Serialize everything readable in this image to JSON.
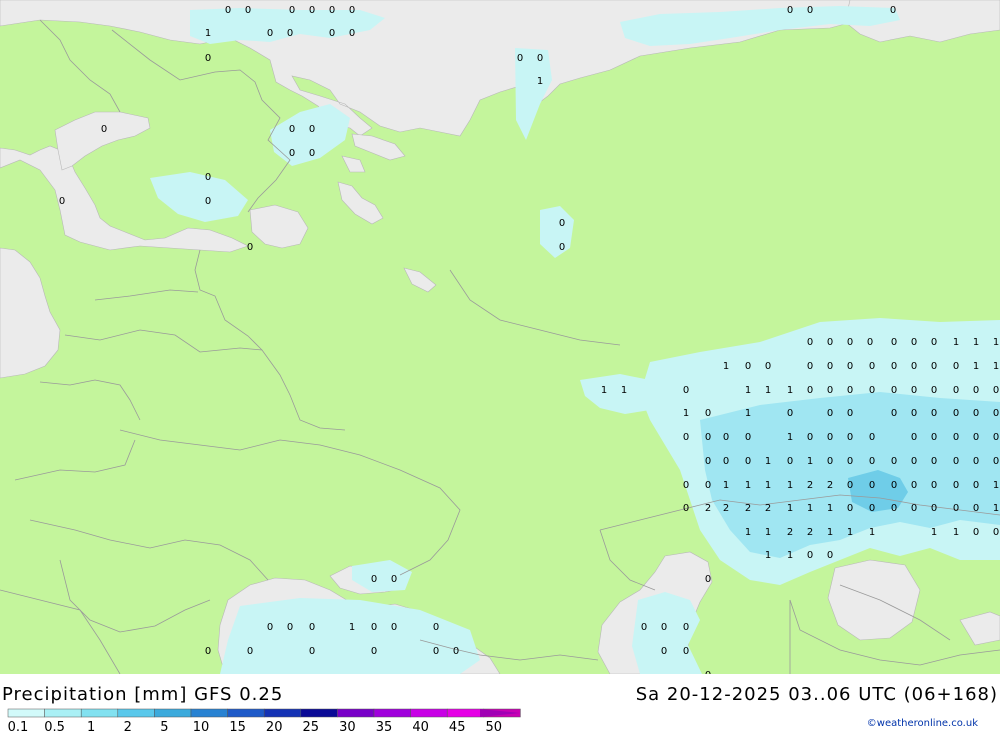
{
  "title": "Precipitation [mm] GFS 0.25",
  "valid_time": "Sa 20-12-2025 03..06 UTC (06+168)",
  "credit": "©weatheronline.co.uk",
  "colors": {
    "land": "#c4f59c",
    "sea": "#ebebeb",
    "border": "#9a9a9a",
    "precip_light": "#c8f5f5",
    "precip_mid": "#a0e6f2",
    "precip_heavy": "#6fcde8"
  },
  "legend": {
    "ticks": [
      "0.1",
      "0.5",
      "1",
      "2",
      "5",
      "10",
      "15",
      "20",
      "25",
      "30",
      "35",
      "40",
      "45",
      "50"
    ],
    "colors": [
      "#d2fafa",
      "#aaf0f5",
      "#82e1f0",
      "#5ac8eb",
      "#3caadc",
      "#2882d2",
      "#1e5ac8",
      "#1432b4",
      "#0a0a96",
      "#7800c8",
      "#a000dc",
      "#c800e6",
      "#e600e6",
      "#c800b4"
    ]
  },
  "values": [
    "0",
    "0",
    "0",
    "0",
    "0",
    "0",
    "0",
    "0",
    "0",
    "1",
    "0",
    "0",
    "0",
    "0",
    "0",
    "0",
    "0",
    "1",
    "0",
    "0",
    "0",
    "0",
    "0",
    "0",
    "0",
    "0",
    "0",
    "0",
    "0",
    "0",
    "0",
    "0",
    "0",
    "0",
    "0",
    "0",
    "1",
    "1",
    "1",
    "1",
    "0",
    "0",
    "0",
    "0",
    "0",
    "0",
    "0",
    "0",
    "0",
    "0",
    "1",
    "1",
    "1",
    "1",
    "0",
    "1",
    "1",
    "1",
    "0",
    "0",
    "0",
    "0",
    "0",
    "0",
    "0",
    "0",
    "0",
    "0",
    "1",
    "0",
    "1",
    "0",
    "0",
    "0",
    "0",
    "0",
    "0",
    "0",
    "0",
    "0",
    "0",
    "0",
    "0",
    "0",
    "1",
    "0",
    "0",
    "0",
    "0",
    "0",
    "0",
    "0",
    "0",
    "0",
    "0",
    "0",
    "0",
    "1",
    "0",
    "1",
    "0",
    "0",
    "0",
    "0",
    "0",
    "0",
    "0",
    "0",
    "0",
    "0",
    "0",
    "1",
    "1",
    "1",
    "1",
    "2",
    "2",
    "0",
    "0",
    "0",
    "0",
    "0",
    "0",
    "0",
    "1",
    "0",
    "2",
    "2",
    "2",
    "2",
    "1",
    "1",
    "1",
    "0",
    "0",
    "0",
    "0",
    "0",
    "0",
    "0",
    "1",
    "1",
    "1",
    "2",
    "2",
    "1",
    "1",
    "1",
    "1",
    "1",
    "0",
    "0",
    "1",
    "1",
    "0",
    "0",
    "0",
    "0",
    "0",
    "0",
    "0",
    "0",
    "1",
    "0",
    "0",
    "0",
    "0",
    "0",
    "0",
    "0",
    "0",
    "0",
    "0",
    "0",
    "0",
    "0",
    "0",
    "0",
    "0",
    "1",
    "0",
    "0",
    "0",
    "0",
    "0",
    "0",
    "0",
    "0",
    "0",
    "0",
    "0"
  ]
}
